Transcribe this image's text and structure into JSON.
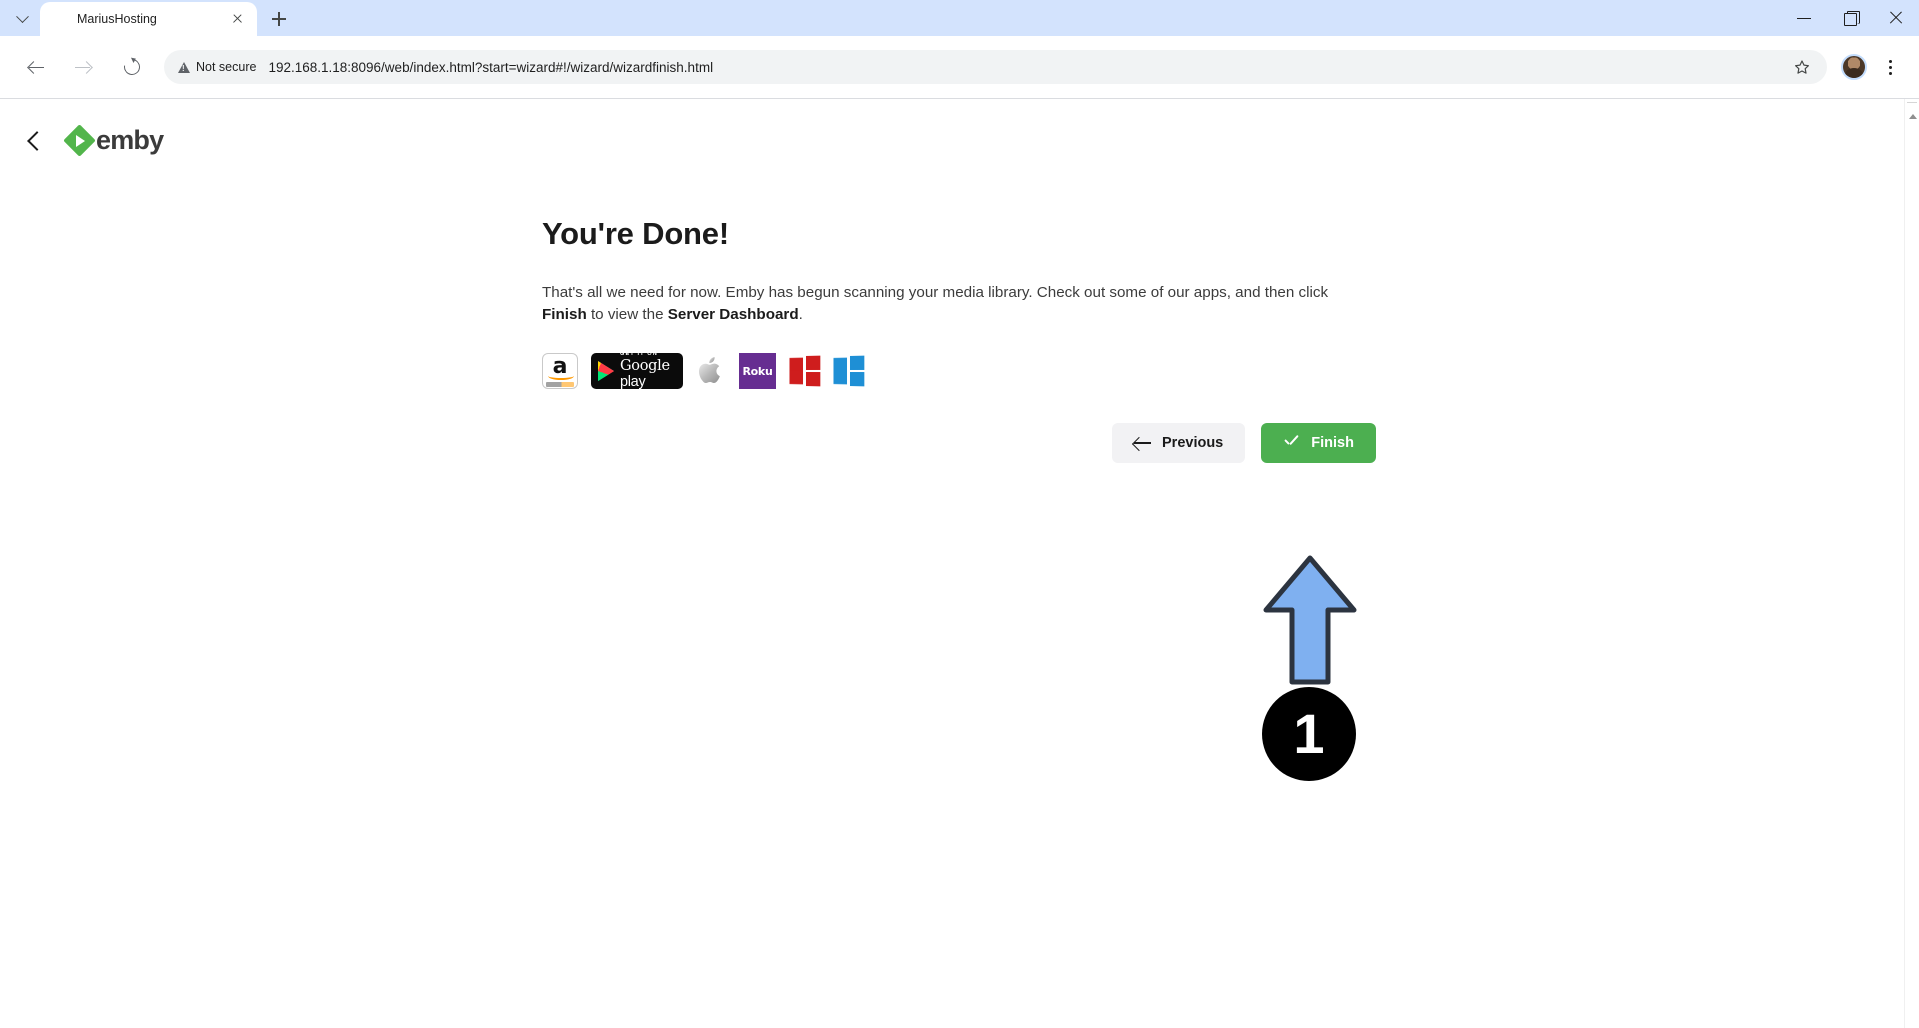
{
  "browser": {
    "tab": {
      "title": "MariusHosting",
      "favicon": "emby-diamond-icon",
      "close_icon": "close-icon"
    },
    "new_tab_icon": "plus-icon",
    "tab_search_icon": "chevron-down-icon",
    "nav": {
      "back_icon": "arrow-left-icon",
      "forward_icon": "arrow-right-icon",
      "reload_icon": "reload-icon"
    },
    "omnibox": {
      "security_label": "Not secure",
      "security_icon": "warning-triangle-icon",
      "url": "192.168.1.18:8096/web/index.html?start=wizard#!/wizard/wizardfinish.html",
      "bookmark_icon": "star-icon"
    },
    "profile_icon": "avatar-icon",
    "menu_icon": "kebab-menu-icon",
    "window_controls": {
      "minimize": "minimize-icon",
      "maximize": "restore-icon",
      "close": "close-icon"
    }
  },
  "page": {
    "header": {
      "back_icon": "chevron-left-icon",
      "logo_mark": "emby-diamond-icon",
      "wordmark": "emby"
    },
    "wizard": {
      "title": "You're Done!",
      "paragraph": {
        "part1": "That's all we need for now. Emby has begun scanning your media library. Check out some of our apps, and then click ",
        "bold1": "Finish",
        "part2": " to view the ",
        "bold2": "Server Dashboard",
        "part3": "."
      },
      "app_badges": [
        {
          "name": "amazon-appstore-badge",
          "label": "a",
          "sublabel": "amazon appstore"
        },
        {
          "name": "google-play-badge",
          "get_it_on": "GET IT ON",
          "brand": "Google",
          "brand2": " play"
        },
        {
          "name": "apple-app-store-badge",
          "label": "apple-logo-icon"
        },
        {
          "name": "roku-badge",
          "label": "Roku"
        },
        {
          "name": "windows-red-badge",
          "label": "windows-logo-icon"
        },
        {
          "name": "windows-blue-badge",
          "label": "windows-logo-icon"
        }
      ],
      "buttons": {
        "previous": "Previous",
        "previous_icon": "arrow-left-icon",
        "finish": "Finish",
        "finish_icon": "check-icon"
      }
    },
    "annotation": {
      "step_number": "1",
      "arrow_icon": "arrow-up-icon",
      "arrow_fill": "#7fb0f0",
      "arrow_stroke": "#2c3440",
      "badge_fill": "#000000"
    },
    "scrollbar_up_icon": "scroll-up-arrow-icon"
  },
  "colors": {
    "tabstrip_bg": "#d3e3fd",
    "emby_green": "#52b54b",
    "finish_green": "#4caf50",
    "previous_gray": "#f2f2f4",
    "roku_purple": "#662d91",
    "windows_red": "#cf1d1d",
    "windows_blue": "#1e8fd5",
    "amazon_orange": "#ff9900"
  }
}
